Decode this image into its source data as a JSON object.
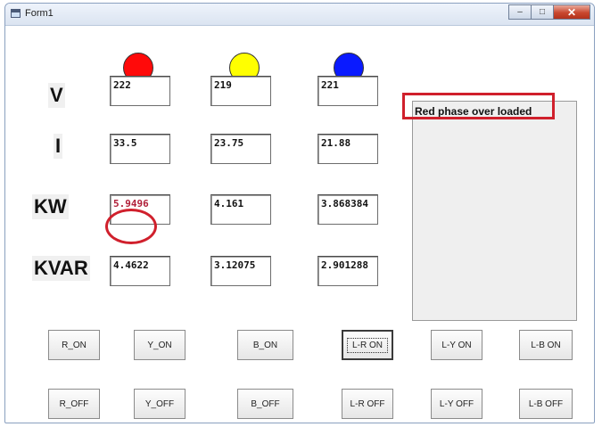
{
  "window": {
    "title": "Form1"
  },
  "labels": {
    "v": "V",
    "i": "I",
    "kw": "KW",
    "kvar": "KVAR"
  },
  "readings": {
    "v": [
      "222",
      "219",
      "221"
    ],
    "i": [
      "33.5",
      "23.75",
      "21.88"
    ],
    "kw": [
      "5.9496",
      "4.161",
      "3.868384"
    ],
    "kvar": [
      "4.4622",
      "3.12075",
      "2.901288"
    ]
  },
  "phase_indicators": [
    "#ff0a0a",
    "#ffff00",
    "#0a1aff"
  ],
  "message": "Red phase over loaded",
  "buttons": {
    "on": [
      "R_ON",
      "Y_ON",
      "B_ON",
      "L-R ON",
      "L-Y ON",
      "L-B ON"
    ],
    "off": [
      "R_OFF",
      "Y_OFF",
      "B_OFF",
      "L-R OFF",
      "L-Y OFF",
      "L-B OFF"
    ]
  }
}
